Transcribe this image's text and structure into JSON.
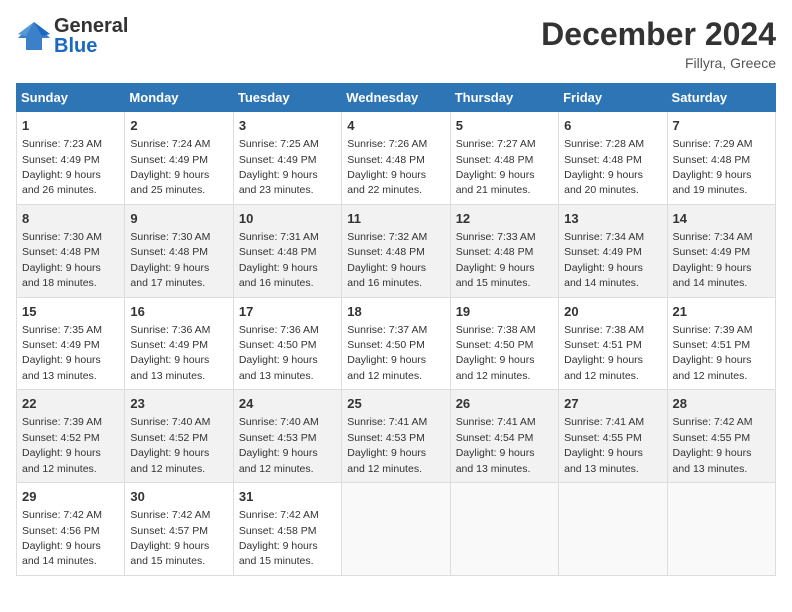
{
  "header": {
    "logo_general": "General",
    "logo_blue": "Blue",
    "title": "December 2024",
    "location": "Fillyra, Greece"
  },
  "weekdays": [
    "Sunday",
    "Monday",
    "Tuesday",
    "Wednesday",
    "Thursday",
    "Friday",
    "Saturday"
  ],
  "weeks": [
    [
      {
        "day": "1",
        "sunrise": "7:23 AM",
        "sunset": "4:49 PM",
        "daylight": "9 hours and 26 minutes."
      },
      {
        "day": "2",
        "sunrise": "7:24 AM",
        "sunset": "4:49 PM",
        "daylight": "9 hours and 25 minutes."
      },
      {
        "day": "3",
        "sunrise": "7:25 AM",
        "sunset": "4:49 PM",
        "daylight": "9 hours and 23 minutes."
      },
      {
        "day": "4",
        "sunrise": "7:26 AM",
        "sunset": "4:48 PM",
        "daylight": "9 hours and 22 minutes."
      },
      {
        "day": "5",
        "sunrise": "7:27 AM",
        "sunset": "4:48 PM",
        "daylight": "9 hours and 21 minutes."
      },
      {
        "day": "6",
        "sunrise": "7:28 AM",
        "sunset": "4:48 PM",
        "daylight": "9 hours and 20 minutes."
      },
      {
        "day": "7",
        "sunrise": "7:29 AM",
        "sunset": "4:48 PM",
        "daylight": "9 hours and 19 minutes."
      }
    ],
    [
      {
        "day": "8",
        "sunrise": "7:30 AM",
        "sunset": "4:48 PM",
        "daylight": "9 hours and 18 minutes."
      },
      {
        "day": "9",
        "sunrise": "7:30 AM",
        "sunset": "4:48 PM",
        "daylight": "9 hours and 17 minutes."
      },
      {
        "day": "10",
        "sunrise": "7:31 AM",
        "sunset": "4:48 PM",
        "daylight": "9 hours and 16 minutes."
      },
      {
        "day": "11",
        "sunrise": "7:32 AM",
        "sunset": "4:48 PM",
        "daylight": "9 hours and 16 minutes."
      },
      {
        "day": "12",
        "sunrise": "7:33 AM",
        "sunset": "4:48 PM",
        "daylight": "9 hours and 15 minutes."
      },
      {
        "day": "13",
        "sunrise": "7:34 AM",
        "sunset": "4:49 PM",
        "daylight": "9 hours and 14 minutes."
      },
      {
        "day": "14",
        "sunrise": "7:34 AM",
        "sunset": "4:49 PM",
        "daylight": "9 hours and 14 minutes."
      }
    ],
    [
      {
        "day": "15",
        "sunrise": "7:35 AM",
        "sunset": "4:49 PM",
        "daylight": "9 hours and 13 minutes."
      },
      {
        "day": "16",
        "sunrise": "7:36 AM",
        "sunset": "4:49 PM",
        "daylight": "9 hours and 13 minutes."
      },
      {
        "day": "17",
        "sunrise": "7:36 AM",
        "sunset": "4:50 PM",
        "daylight": "9 hours and 13 minutes."
      },
      {
        "day": "18",
        "sunrise": "7:37 AM",
        "sunset": "4:50 PM",
        "daylight": "9 hours and 12 minutes."
      },
      {
        "day": "19",
        "sunrise": "7:38 AM",
        "sunset": "4:50 PM",
        "daylight": "9 hours and 12 minutes."
      },
      {
        "day": "20",
        "sunrise": "7:38 AM",
        "sunset": "4:51 PM",
        "daylight": "9 hours and 12 minutes."
      },
      {
        "day": "21",
        "sunrise": "7:39 AM",
        "sunset": "4:51 PM",
        "daylight": "9 hours and 12 minutes."
      }
    ],
    [
      {
        "day": "22",
        "sunrise": "7:39 AM",
        "sunset": "4:52 PM",
        "daylight": "9 hours and 12 minutes."
      },
      {
        "day": "23",
        "sunrise": "7:40 AM",
        "sunset": "4:52 PM",
        "daylight": "9 hours and 12 minutes."
      },
      {
        "day": "24",
        "sunrise": "7:40 AM",
        "sunset": "4:53 PM",
        "daylight": "9 hours and 12 minutes."
      },
      {
        "day": "25",
        "sunrise": "7:41 AM",
        "sunset": "4:53 PM",
        "daylight": "9 hours and 12 minutes."
      },
      {
        "day": "26",
        "sunrise": "7:41 AM",
        "sunset": "4:54 PM",
        "daylight": "9 hours and 13 minutes."
      },
      {
        "day": "27",
        "sunrise": "7:41 AM",
        "sunset": "4:55 PM",
        "daylight": "9 hours and 13 minutes."
      },
      {
        "day": "28",
        "sunrise": "7:42 AM",
        "sunset": "4:55 PM",
        "daylight": "9 hours and 13 minutes."
      }
    ],
    [
      {
        "day": "29",
        "sunrise": "7:42 AM",
        "sunset": "4:56 PM",
        "daylight": "9 hours and 14 minutes."
      },
      {
        "day": "30",
        "sunrise": "7:42 AM",
        "sunset": "4:57 PM",
        "daylight": "9 hours and 15 minutes."
      },
      {
        "day": "31",
        "sunrise": "7:42 AM",
        "sunset": "4:58 PM",
        "daylight": "9 hours and 15 minutes."
      },
      null,
      null,
      null,
      null
    ]
  ],
  "labels": {
    "sunrise": "Sunrise:",
    "sunset": "Sunset:",
    "daylight": "Daylight:"
  }
}
